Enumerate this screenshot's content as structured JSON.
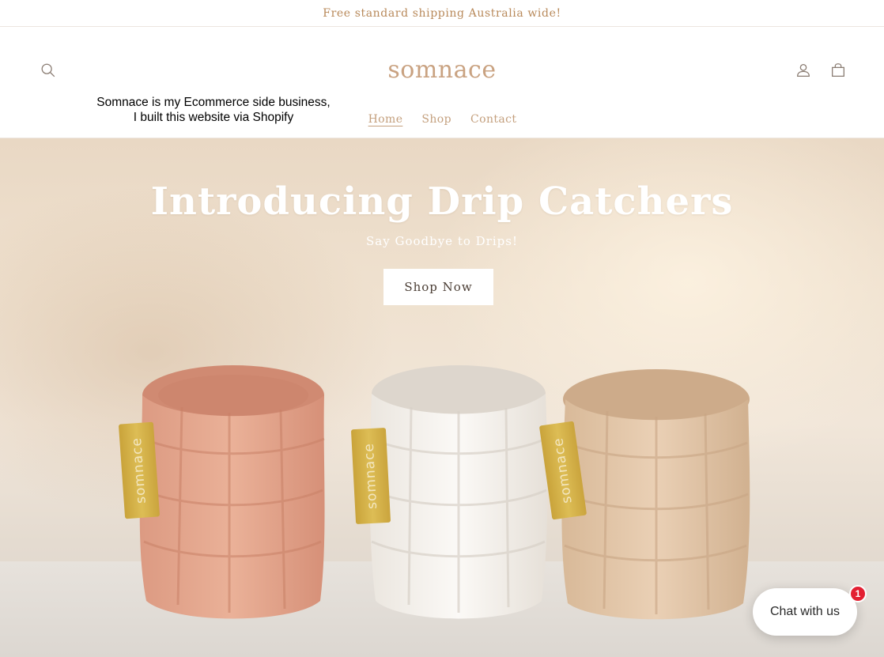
{
  "announcement": {
    "text": "Free standard shipping Australia wide!"
  },
  "header": {
    "logo_text": "somnace",
    "side_note_line1": "Somnace is my Ecommerce side business,",
    "side_note_line2": "I built this website via Shopify",
    "search_icon": "search-icon",
    "account_icon": "account-icon",
    "cart_icon": "cart-icon"
  },
  "nav": {
    "items": [
      {
        "label": "Home",
        "active": true
      },
      {
        "label": "Shop",
        "active": false
      },
      {
        "label": "Contact",
        "active": false
      }
    ]
  },
  "hero": {
    "title": "Introducing Drip Catchers",
    "subtitle": "Say Goodbye to Drips!",
    "cta_label": "Shop Now",
    "products": [
      {
        "color": "#e7a88e",
        "tag_text": "somnace"
      },
      {
        "color": "#f6f3ef",
        "tag_text": "somnace"
      },
      {
        "color": "#e6c9ad",
        "tag_text": "somnace"
      }
    ]
  },
  "chat": {
    "label": "Chat with us",
    "badge_count": "1"
  },
  "colors": {
    "accent": "#c4a07e",
    "announcement": "#b8895a",
    "tag_gold": "#d4b047",
    "badge_red": "#e32032"
  }
}
